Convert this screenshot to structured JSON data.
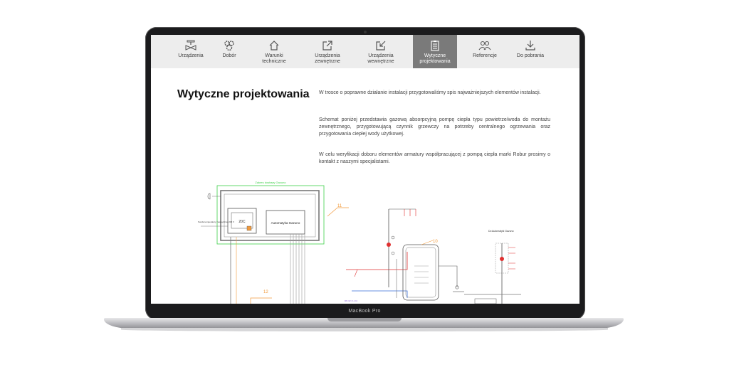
{
  "nav": {
    "items": [
      {
        "label": "Urządzenia",
        "icon": "valve-icon"
      },
      {
        "label": "Dobór",
        "icon": "gears-icon"
      },
      {
        "label": "Warunki\ntechniczne",
        "icon": "house-icon"
      },
      {
        "label": "Urządzenia\nzewnętrzne",
        "icon": "external-link-icon"
      },
      {
        "label": "Urządzenia\nwewnętrzne",
        "icon": "internal-link-icon"
      },
      {
        "label": "Wytyczne\nprojektowania",
        "icon": "clipboard-icon",
        "active": true
      },
      {
        "label": "Referencje",
        "icon": "people-icon"
      },
      {
        "label": "Do pobrania",
        "icon": "download-icon"
      }
    ]
  },
  "content": {
    "title": "Wytyczne projektowania",
    "paragraphs": [
      "W trosce o poprawne działanie instalacji przygotowaliśmy spis najważniejszych elementów instalacji.",
      "Schemat poniżej przedstawia gazową absorpcyjną pompę ciepła typu powietrze/woda do montażu zewnętrznego, przygotowującą czynnik grzewczy na potrzeby centralnego ogrzewania oraz przygotowania ciepłej wody użytkowej.",
      "W celu weryfikacji doboru elementów armatury współpracującej z pompą ciepła marki Robur prosimy o kontakt z naszymi specjalistami."
    ]
  },
  "diagram": {
    "box_title": "Zakres dostawy Gazuno",
    "automation_label": "Automatyka Gazuno",
    "remote_label": "Automatyki Gazuno",
    "remote_prefix": "Do",
    "panel_text": "20C",
    "side_note": "Sonda temperatury\nzewnętrznej 230 V",
    "markers": [
      "11",
      "12",
      "10"
    ],
    "vertical_label": "DN 32 / 1 1/4",
    "accent_orange": "#f29a3c",
    "accent_green": "#3ecf4a",
    "line_red": "#e03030",
    "line_blue": "#3a6fd8"
  },
  "device": {
    "brand": "MacBook Pro"
  }
}
